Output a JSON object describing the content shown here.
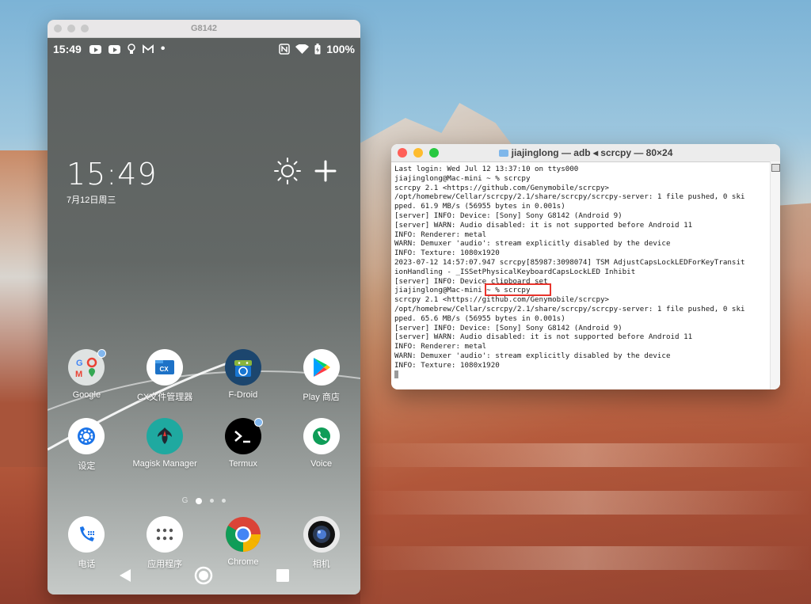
{
  "phone_window": {
    "title": "G8142",
    "status": {
      "time": "15:49",
      "battery": "100%"
    },
    "clock": {
      "time": "15:49",
      "date": "7月12日周三"
    },
    "apps_row1": [
      {
        "label": "Google",
        "icon": "google-folder-icon",
        "badge": true
      },
      {
        "label": "CX文件管理器",
        "icon": "cx-file-manager-icon",
        "badge": false
      },
      {
        "label": "F-Droid",
        "icon": "fdroid-icon",
        "badge": false
      },
      {
        "label": "Play 商店",
        "icon": "play-store-icon",
        "badge": false
      }
    ],
    "apps_row2": [
      {
        "label": "设定",
        "icon": "settings-gear-icon",
        "badge": false
      },
      {
        "label": "Magisk Manager",
        "icon": "magisk-icon",
        "badge": false
      },
      {
        "label": "Termux",
        "icon": "termux-icon",
        "badge": true
      },
      {
        "label": "Voice",
        "icon": "voice-icon",
        "badge": false
      }
    ],
    "dock": [
      {
        "label": "电话",
        "icon": "phone-icon"
      },
      {
        "label": "应用程序",
        "icon": "app-drawer-icon"
      },
      {
        "label": "Chrome",
        "icon": "chrome-icon"
      },
      {
        "label": "相机",
        "icon": "camera-icon"
      }
    ],
    "pager_letter": "G"
  },
  "terminal": {
    "title": "jiajinglong — adb ◂ scrcpy — 80×24",
    "lines": [
      "Last login: Wed Jul 12 13:37:10 on ttys000",
      "jiajinglong@Mac-mini ~ % scrcpy",
      "scrcpy 2.1 <https://github.com/Genymobile/scrcpy>",
      "/opt/homebrew/Cellar/scrcpy/2.1/share/scrcpy/scrcpy-server: 1 file pushed, 0 ski",
      "pped. 61.9 MB/s (56955 bytes in 0.001s)",
      "[server] INFO: Device: [Sony] Sony G8142 (Android 9)",
      "[server] WARN: Audio disabled: it is not supported before Android 11",
      "INFO: Renderer: metal",
      "WARN: Demuxer 'audio': stream explicitly disabled by the device",
      "INFO: Texture: 1080x1920",
      "2023-07-12 14:57:07.947 scrcpy[85987:3098074] TSM AdjustCapsLockLEDForKeyTransit",
      "ionHandling - _ISSetPhysicalKeyboardCapsLockLED Inhibit",
      "[server] INFO: Device clipboard set",
      "jiajinglong@Mac-mini ~ % scrcpy",
      "scrcpy 2.1 <https://github.com/Genymobile/scrcpy>",
      "/opt/homebrew/Cellar/scrcpy/2.1/share/scrcpy/scrcpy-server: 1 file pushed, 0 ski",
      "pped. 65.6 MB/s (56955 bytes in 0.001s)",
      "[server] INFO: Device: [Sony] Sony G8142 (Android 9)",
      "[server] WARN: Audio disabled: it is not supported before Android 11",
      "INFO: Renderer: metal",
      "WARN: Demuxer 'audio': stream explicitly disabled by the device",
      "INFO: Texture: 1080x1920"
    ]
  },
  "colors": {
    "close": "#ff5f57",
    "minimize": "#febc2e",
    "zoom": "#28c840",
    "highlight": "#e8342c"
  }
}
